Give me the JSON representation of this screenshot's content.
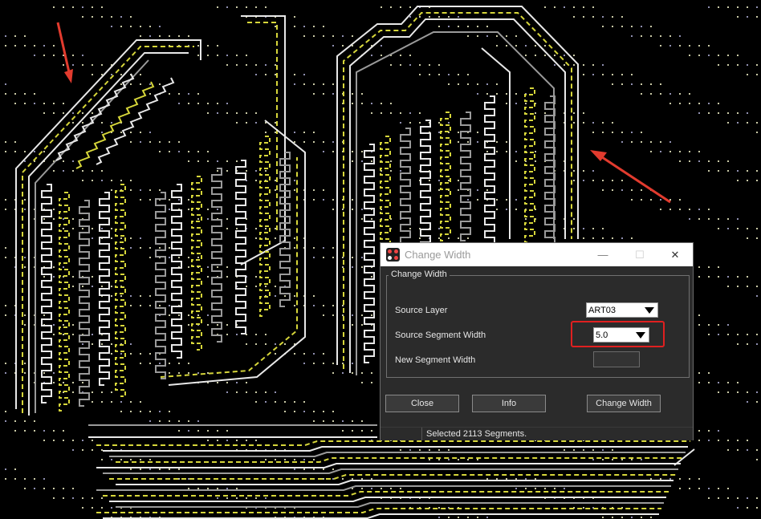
{
  "dialog": {
    "title": "Change Width",
    "window_buttons": {
      "minimize": "—",
      "maximize": "☐",
      "close": "✕"
    },
    "group_label": "Change Width",
    "source_layer_label": "Source Layer",
    "source_layer_value": "ART03",
    "source_width_label": "Source Segment Width",
    "source_width_value": "5.0",
    "new_width_label": "New Segment Width",
    "new_width_value": "",
    "close_label": "Close",
    "info_label": "Info",
    "change_width_label": "Change Width",
    "status_text": "Selected 2113 Segments."
  },
  "annotations": {
    "arrow_color": "#e23b2e",
    "highlight_color": "#e02020"
  },
  "colors": {
    "trace_white": "#e8e8e8",
    "trace_gray": "#9a9a9a",
    "trace_yellow": "#d6d63a",
    "via": "#c9c9a6"
  }
}
